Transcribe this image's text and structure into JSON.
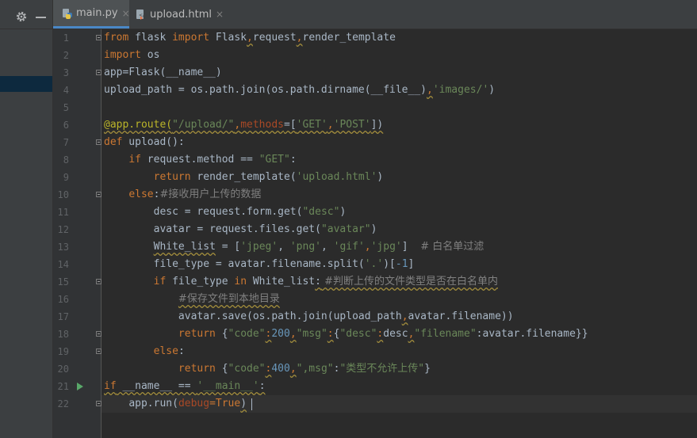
{
  "tabs": [
    {
      "label": "main.py",
      "close": "×",
      "active": true,
      "icon": "python-file-icon"
    },
    {
      "label": "upload.html",
      "close": "×",
      "active": false,
      "icon": "html-file-icon"
    }
  ],
  "toolbar": {
    "settings_icon": "gear-icon",
    "minimize_icon": "minimize-icon"
  },
  "gutter": {
    "line_numbers": [
      "1",
      "2",
      "3",
      "4",
      "5",
      "6",
      "7",
      "8",
      "9",
      "10",
      "11",
      "12",
      "13",
      "14",
      "15",
      "16",
      "17",
      "18",
      "19",
      "20",
      "21",
      "22"
    ],
    "run_icon": "run-gutter-icon"
  },
  "code": {
    "l1": {
      "kw1": "from",
      "t1": " flask ",
      "kw2": "import",
      "t2": " Flask",
      "c1": ",",
      "t3": "request",
      "c2": ",",
      "t4": "render_template"
    },
    "l2": {
      "kw1": "import",
      "t1": " os"
    },
    "l3": {
      "t1": "app=Flask(__name__)"
    },
    "l4": {
      "t1": "upload_path = os.path.join(os.path.dirname(__file__)",
      "c1": ",",
      "s1": "'images/'",
      "t2": ")"
    },
    "l6": {
      "d1": "@app.route(",
      "s1": "\"/upload/\"",
      "c1": ",",
      "p1": "methods",
      "t1": "=[",
      "s2": "'GET'",
      "c2": ",",
      "s3": "'POST'",
      "t2": "])"
    },
    "l7": {
      "kw1": "def",
      "t1": " upload():"
    },
    "l8": {
      "i1": "    ",
      "kw1": "if",
      "t1": " request.method == ",
      "s1": "\"GET\"",
      "t2": ":"
    },
    "l9": {
      "i1": "        ",
      "kw1": "return",
      "t1": " render_template(",
      "s1": "'upload.html'",
      "t2": ")"
    },
    "l10": {
      "i1": "    ",
      "kw1": "else",
      "t1": ":",
      "cm1": "#接收用户上传的数据"
    },
    "l11": {
      "i1": "        ",
      "t1": "desc = request.form.get(",
      "s1": "\"desc\"",
      "t2": ")"
    },
    "l12": {
      "i1": "        ",
      "t1": "avatar = request.files.get(",
      "s1": "\"avatar\"",
      "t2": ")"
    },
    "l13": {
      "i1": "        ",
      "t1": "White_list",
      "t2": " = [",
      "s1": "'jpeg'",
      "t3": ", ",
      "s2": "'png'",
      "t4": ", ",
      "s3": "'gif'",
      "c1": ",",
      "s4": "'jpg'",
      "t5": "]  ",
      "cm1": "# 白名单过滤"
    },
    "l14": {
      "i1": "        ",
      "t1": "file_type = avatar.filename.split(",
      "s1": "'.'",
      "t2": ")[",
      "n1": "-1",
      "t3": "]"
    },
    "l15": {
      "i1": "        ",
      "kw1": "if",
      "t1": " file_type ",
      "kw2": "in",
      "t2": " White_list",
      "t3": ":",
      "cm1": " #判断上传的文件类型是否在白名单内"
    },
    "l16": {
      "i1": "            ",
      "cm1": "#保存文件到本地目录"
    },
    "l17": {
      "i1": "            ",
      "t1": "avatar.save(os.path.join(upload_path",
      "c1": ",",
      "t2": "avatar.filename))"
    },
    "l18": {
      "i1": "            ",
      "kw1": "return",
      "t1": " {",
      "s1": "\"code\"",
      "c1": ":",
      "n1": "200",
      "c2": ",",
      "s2": "\"msg\"",
      "c3": ":",
      "t2": "{",
      "s3": "\"desc\"",
      "c4": ":",
      "t3": "desc",
      "c5": ",",
      "s4": "\"filename\"",
      "t4": ":avatar.filename}}"
    },
    "l19": {
      "i1": "        ",
      "kw1": "else",
      "t1": ":"
    },
    "l20": {
      "i1": "            ",
      "kw1": "return",
      "t1": " {",
      "s1": "\"code\"",
      "c1": ":",
      "n1": "400",
      "c2": ",",
      "s2": "\",msg\"",
      "t2": ":",
      "s3": "\"类型不允许上传\"",
      "t3": "}"
    },
    "l21": {
      "kw1": "if",
      "t1": " __name__ == ",
      "s1": "'__main__'",
      "t2": ":"
    },
    "l22": {
      "i1": "    ",
      "t1": "app.run(",
      "p1": "debug",
      "t2": "=",
      "kw1": "True",
      "t3": ")"
    }
  },
  "colors": {
    "keyword": "#cc7832",
    "string": "#6a8759",
    "number": "#6897bb",
    "comment": "#808080",
    "decorator": "#bbb529",
    "text": "#a9b7c6",
    "accent": "#4a88c7"
  }
}
